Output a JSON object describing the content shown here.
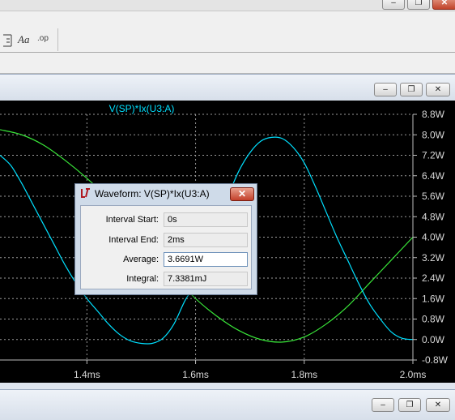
{
  "window_buttons": {
    "minimize_glyph": "‒",
    "restore_glyph": "❐",
    "close_glyph": "✕"
  },
  "toolbar": {
    "icon_label_1": "Aa",
    "icon_label_2": ".op"
  },
  "plot": {
    "trace_title": "V(SP)*Ix(U3:A)",
    "trace_color": "#00e0ff",
    "second_trace_color": "#39e639",
    "grid_color": "#9a9a9a"
  },
  "chart_data": {
    "type": "line",
    "title": "V(SP)*Ix(U3:A)",
    "xlabel": "",
    "ylabel": "",
    "x_ticks": [
      "1.4ms",
      "1.6ms",
      "1.8ms",
      "2.0ms"
    ],
    "y_ticks": [
      "8.8W",
      "8.0W",
      "7.2W",
      "6.4W",
      "5.6W",
      "4.8W",
      "4.0W",
      "3.2W",
      "2.4W",
      "1.6W",
      "0.8W",
      "0.0W",
      "-0.8W"
    ],
    "xlim": [
      1.24,
      2.0
    ],
    "ylim": [
      -0.8,
      8.8
    ],
    "grid": true,
    "series": [
      {
        "name": "V(SP)*Ix(U3:A)",
        "color": "#00e0ff",
        "x": [
          1.24,
          1.26,
          1.28,
          1.3,
          1.32,
          1.34,
          1.36,
          1.38,
          1.4,
          1.42,
          1.44,
          1.46,
          1.48,
          1.5,
          1.52,
          1.54,
          1.56,
          1.58,
          1.6,
          1.62,
          1.64,
          1.66,
          1.68,
          1.7,
          1.72,
          1.74,
          1.76,
          1.78,
          1.8,
          1.82,
          1.84,
          1.86,
          1.88,
          1.9,
          1.92,
          1.94,
          1.96,
          1.98,
          2.0
        ],
        "y": [
          7.2,
          6.8,
          6.1,
          5.3,
          4.5,
          3.7,
          2.9,
          2.2,
          1.6,
          1.1,
          0.6,
          0.2,
          -0.05,
          -0.15,
          -0.15,
          0.05,
          0.6,
          1.5,
          2.2,
          3.2,
          4.4,
          5.6,
          6.6,
          7.3,
          7.75,
          7.9,
          7.85,
          7.5,
          6.9,
          6.0,
          5.0,
          4.0,
          3.1,
          2.2,
          1.4,
          0.8,
          0.3,
          0.05,
          0.0
        ]
      },
      {
        "name": "",
        "color": "#39e639",
        "x": [
          1.24,
          1.28,
          1.32,
          1.36,
          1.4,
          1.44,
          1.48,
          1.52,
          1.56,
          1.6,
          1.64,
          1.68,
          1.72,
          1.76,
          1.8,
          1.84,
          1.88,
          1.92,
          1.96,
          2.0
        ],
        "y": [
          8.2,
          8.0,
          7.6,
          7.0,
          6.3,
          5.5,
          4.5,
          3.5,
          2.5,
          1.6,
          0.9,
          0.35,
          0.0,
          -0.1,
          0.1,
          0.6,
          1.3,
          2.2,
          3.1,
          4.0
        ]
      }
    ]
  },
  "dialog": {
    "title": "Waveform: V(SP)*Ix(U3:A)",
    "close_glyph": "✕",
    "rows": [
      {
        "label": "Interval Start:",
        "value": "0s"
      },
      {
        "label": "Interval End:",
        "value": "2ms"
      },
      {
        "label": "Average:",
        "value": "3.6691W"
      },
      {
        "label": "Integral:",
        "value": "7.3381mJ"
      }
    ]
  }
}
